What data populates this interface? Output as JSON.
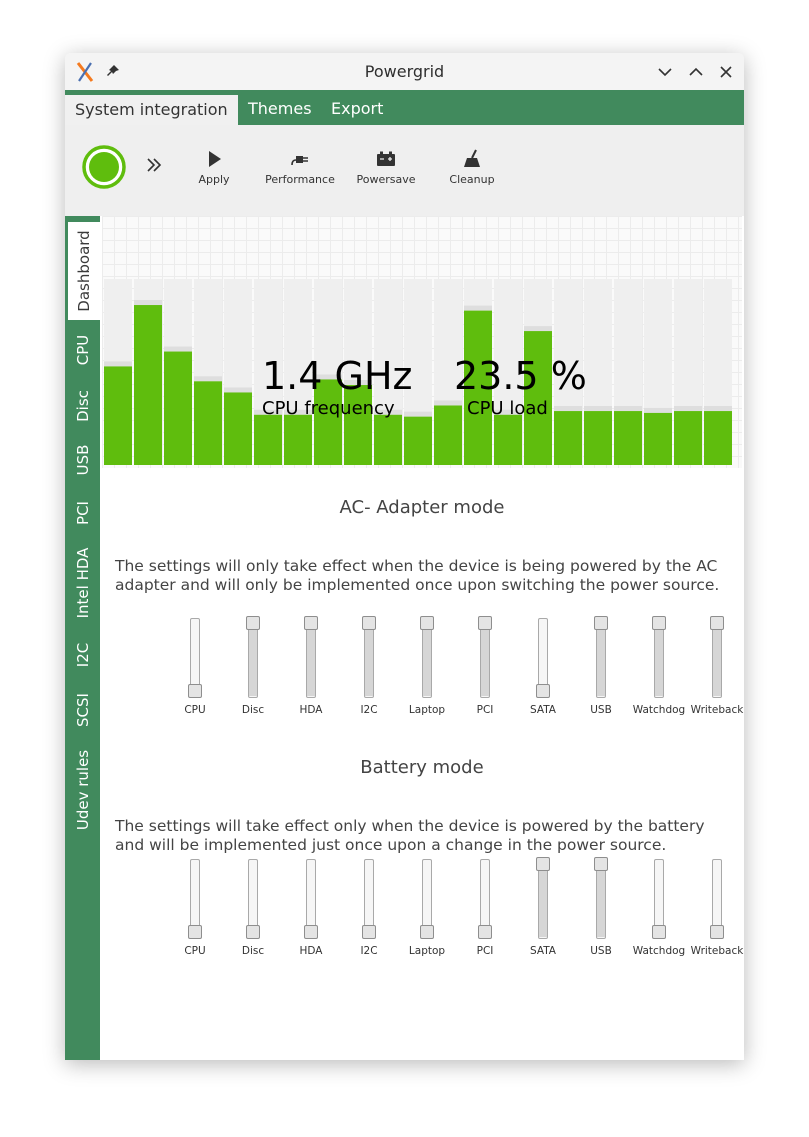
{
  "window": {
    "title": "Powergrid"
  },
  "menu": {
    "tabs": [
      "System integration",
      "Themes",
      "Export"
    ]
  },
  "toolbar": {
    "buttons": [
      {
        "label": "Apply",
        "icon": "play-icon"
      },
      {
        "label": "Performance",
        "icon": "plug-icon"
      },
      {
        "label": "Powersave",
        "icon": "battery-icon"
      },
      {
        "label": "Cleanup",
        "icon": "broom-icon"
      }
    ]
  },
  "sidebar": {
    "tabs": [
      "Dashboard",
      "CPU",
      "Disc",
      "USB",
      "PCI",
      "Intel HDA",
      "I2C",
      "SCSI",
      "Udev rules"
    ]
  },
  "dashboard": {
    "cpu_frequency": {
      "value": "1.4 GHz",
      "label": "CPU frequency"
    },
    "cpu_load": {
      "value": "23.5 %",
      "label": "CPU load"
    }
  },
  "chart_data": {
    "type": "bar",
    "values": [
      53,
      86,
      61,
      45,
      39,
      27,
      27,
      46,
      43,
      27,
      26,
      32,
      83,
      27,
      72,
      29,
      29,
      29,
      28,
      29,
      29
    ],
    "ylim": [
      0,
      100
    ],
    "colors": {
      "bar": "#5fbd0d",
      "track": "#efefef"
    }
  },
  "ac_mode": {
    "title": "AC- Adapter mode",
    "description": "The settings will only take effect when the device is being powered by the AC adapter and will only be implemented once upon switching the power source.",
    "sliders": [
      {
        "label": "CPU",
        "level": 0
      },
      {
        "label": "Disc",
        "level": 1
      },
      {
        "label": "HDA",
        "level": 1
      },
      {
        "label": "I2C",
        "level": 1
      },
      {
        "label": "Laptop",
        "level": 1
      },
      {
        "label": "PCI",
        "level": 1
      },
      {
        "label": "SATA",
        "level": 0
      },
      {
        "label": "USB",
        "level": 1
      },
      {
        "label": "Watchdog",
        "level": 1
      },
      {
        "label": "Writeback",
        "level": 1
      }
    ]
  },
  "battery_mode": {
    "title": "Battery mode",
    "description": "The settings will take effect only when the device is powered by the battery and will be implemented just once upon a change in the power source.",
    "sliders": [
      {
        "label": "CPU",
        "level": 0
      },
      {
        "label": "Disc",
        "level": 0
      },
      {
        "label": "HDA",
        "level": 0
      },
      {
        "label": "I2C",
        "level": 0
      },
      {
        "label": "Laptop",
        "level": 0
      },
      {
        "label": "PCI",
        "level": 0
      },
      {
        "label": "SATA",
        "level": 1
      },
      {
        "label": "USB",
        "level": 1
      },
      {
        "label": "Watchdog",
        "level": 0
      },
      {
        "label": "Writeback",
        "level": 0
      }
    ]
  },
  "colors": {
    "accent": "#418a5d",
    "power_ring": "#5fbd0d"
  }
}
